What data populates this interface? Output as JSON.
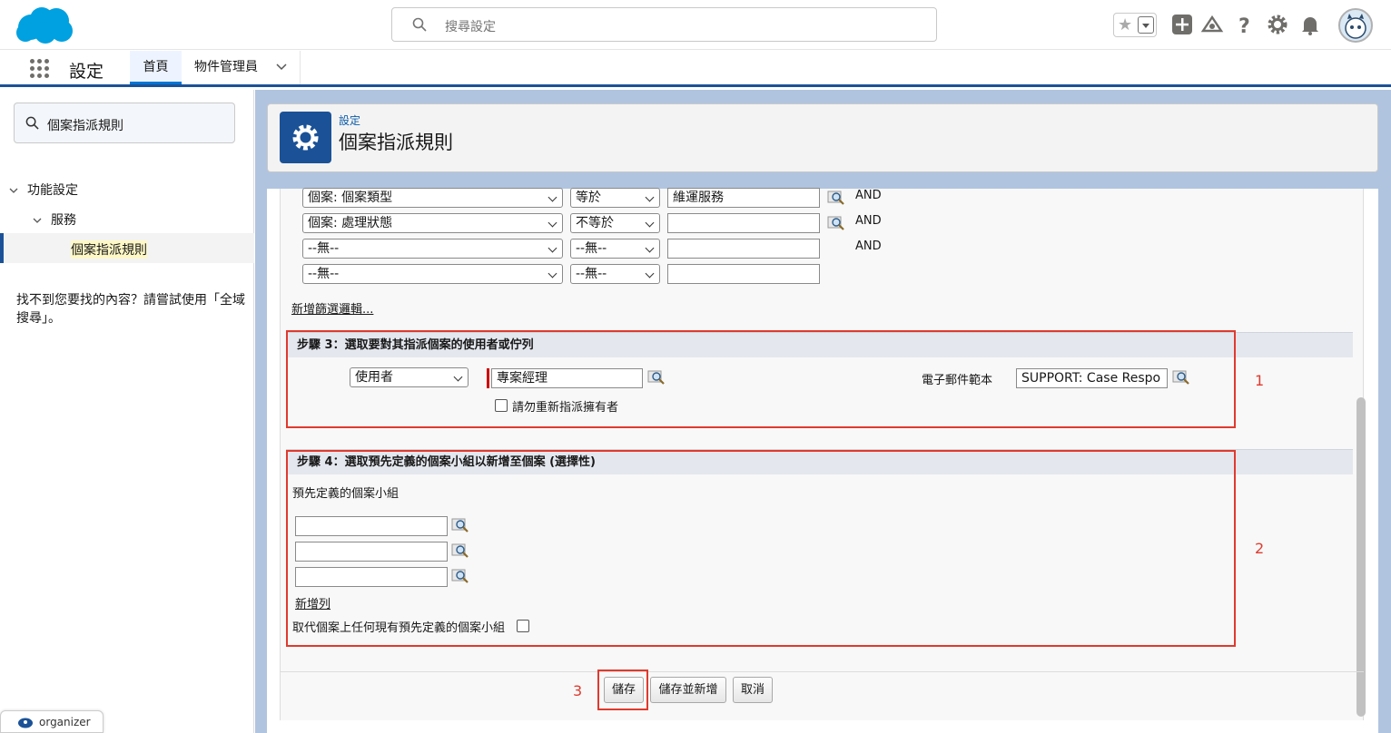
{
  "header": {
    "search_placeholder": "搜尋設定",
    "icons": [
      "salesforce-cloud-logo",
      "star-icon",
      "chevron-down-icon",
      "plus-icon",
      "trailhead-icon",
      "help-icon",
      "gear-icon",
      "bell-icon",
      "avatar"
    ]
  },
  "nav": {
    "app_name": "設定",
    "tabs": [
      {
        "label": "首頁",
        "active": true
      },
      {
        "label": "物件管理員",
        "active": false
      }
    ]
  },
  "sidebar": {
    "quick_find": "個案指派規則",
    "tree": [
      {
        "label": "功能設定",
        "expanded": true
      },
      {
        "label": "服務",
        "expanded": true
      },
      {
        "label": "個案指派規則",
        "selected": true
      }
    ],
    "not_found": "找不到您要找的內容？請嘗試使用「全域搜尋」。"
  },
  "page_header": {
    "breadcrumb": "設定",
    "title": "個案指派規則"
  },
  "criteria": {
    "rows": [
      {
        "field": "個案: 個案類型",
        "operator": "等於",
        "value": "維運服務",
        "has_lookup": true,
        "connector": "AND"
      },
      {
        "field": "個案: 處理狀態",
        "operator": "不等於",
        "value": "",
        "has_lookup": true,
        "connector": "AND"
      },
      {
        "field": "--無--",
        "operator": "--無--",
        "value": "",
        "has_lookup": false,
        "connector": "AND"
      },
      {
        "field": "--無--",
        "operator": "--無--",
        "value": "",
        "has_lookup": false,
        "connector": ""
      }
    ],
    "add_filter_logic": "新增篩選邏輯..."
  },
  "step3": {
    "title": "步驟 3：選取要對其指派個案的使用者或佇列",
    "assignee_type": "使用者",
    "assignee": "專案經理",
    "do_not_reassign_label": "請勿重新指派擁有者",
    "do_not_reassign_checked": false,
    "email_template_label": "電子郵件範本",
    "email_template": "SUPPORT: Case Respo"
  },
  "step4": {
    "title": "步驟 4：選取預先定義的個案小組以新增至個案 (選擇性)",
    "teams_label": "預先定義的個案小組",
    "teams": [
      "",
      "",
      ""
    ],
    "add_row": "新增列",
    "replace_label": "取代個案上任何現有預先定義的個案小組",
    "replace_checked": false
  },
  "buttons": {
    "save": "儲存",
    "save_new": "儲存並新增",
    "cancel": "取消"
  },
  "annotations": {
    "a1": "1",
    "a2": "2",
    "a3": "3"
  },
  "organizer": {
    "label": "organizer"
  },
  "colors": {
    "brand_blue": "#1b5297",
    "annotation_red": "#e03a2e",
    "salesforce_cloud": "#00a1e0"
  }
}
